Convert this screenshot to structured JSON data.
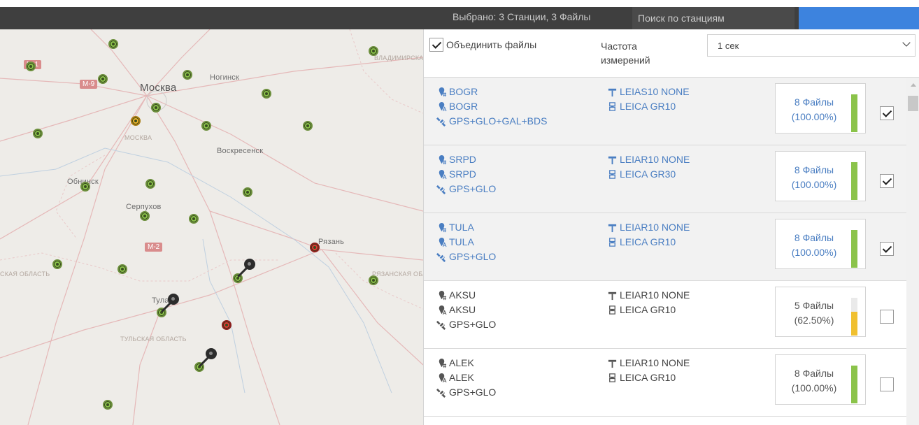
{
  "topbar": {
    "selected_label": "Выбрано:",
    "selected_value": "3 Станции, 3 Файлы",
    "search_placeholder": "Поиск по станциям"
  },
  "map": {
    "labels": {
      "moscow": "Москва",
      "noginsk": "Ногинск",
      "voskresensk": "Воскресенск",
      "obninsk": "Обнинск",
      "serpukhov": "Серпухов",
      "ryazan": "Рязань",
      "tula": "Тула",
      "moscow_region": "МОСКВА",
      "vladimir_region": "ВЛАДИМИРСКА ОБЛАСТЬ",
      "tula_region": "ТУЛЬСКАЯ ОБЛАСТЬ",
      "ryazan_region": "РЯЗАНСКАЯ ОБЛАСТЬ",
      "kaluga_region": "СКАЯ ОБЛАСТЬ"
    },
    "roads": {
      "m9": "М-9",
      "m2": "М-2",
      "m1": "М-1"
    }
  },
  "options": {
    "merge_label": "Объединить файлы",
    "merge_checked": true,
    "frequency_label": "Частота измерений",
    "frequency_value": "1 сек"
  },
  "stations": [
    {
      "code": "BOGR",
      "marker": "BOGR",
      "systems": "GPS+GLO+GAL+BDS",
      "antenna": "LEIAS10 NONE",
      "receiver": "LEICA GR10",
      "files": "8 Файлы",
      "percent": "(100.00%)",
      "fill": 1.0,
      "checked": true
    },
    {
      "code": "SRPD",
      "marker": "SRPD",
      "systems": "GPS+GLO",
      "antenna": "LEIAR10 NONE",
      "receiver": "LEICA GR30",
      "files": "8 Файлы",
      "percent": "(100.00%)",
      "fill": 1.0,
      "checked": true
    },
    {
      "code": "TULA",
      "marker": "TULA",
      "systems": "GPS+GLO",
      "antenna": "LEIAR10 NONE",
      "receiver": "LEICA GR10",
      "files": "8 Файлы",
      "percent": "(100.00%)",
      "fill": 1.0,
      "checked": true
    },
    {
      "code": "AKSU",
      "marker": "AKSU",
      "systems": "GPS+GLO",
      "antenna": "LEIAR10 NONE",
      "receiver": "LEICA GR10",
      "files": "5 Файлы",
      "percent": "(62.50%)",
      "fill": 0.625,
      "checked": false
    },
    {
      "code": "ALEK",
      "marker": "ALEK",
      "systems": "GPS+GLO",
      "antenna": "LEIAR10 NONE",
      "receiver": "LEICA GR10",
      "files": "8 Файлы",
      "percent": "(100.00%)",
      "fill": 1.0,
      "checked": false
    }
  ],
  "colors": {
    "accent": "#3d83de",
    "selected_text": "#4a7ec2",
    "bar_full": "#8bc34a",
    "bar_partial": "#f0c030",
    "station_green": "#8bc34a",
    "station_yellow": "#f0b429",
    "station_red": "#e53935"
  },
  "icons": {
    "site": "marker-hash-icon",
    "marker": "marker-a-icon",
    "systems": "satellite-icon",
    "antenna": "antenna-icon",
    "receiver": "receiver-icon"
  }
}
